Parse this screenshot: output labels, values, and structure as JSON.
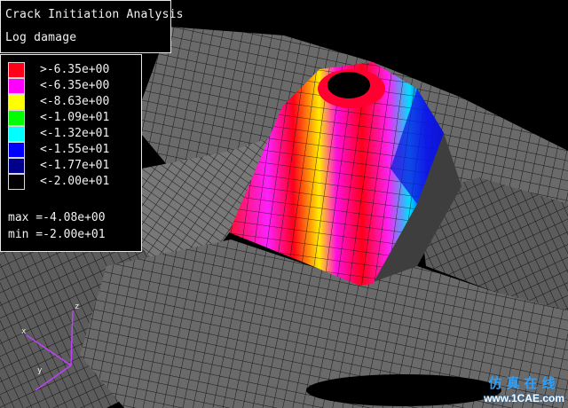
{
  "title_panel": {
    "line1": "Crack Initiation Analysis",
    "line2": "Log damage"
  },
  "legend": {
    "entries": [
      {
        "label": ">-6.35e+00",
        "color": "#ff0018"
      },
      {
        "label": "<-6.35e+00",
        "color": "#ff00ff"
      },
      {
        "label": "<-8.63e+00",
        "color": "#ffff00"
      },
      {
        "label": "<-1.09e+01",
        "color": "#00ff00"
      },
      {
        "label": "<-1.32e+01",
        "color": "#00ffff"
      },
      {
        "label": "<-1.55e+01",
        "color": "#0000ff"
      },
      {
        "label": "<-1.77e+01",
        "color": "#00008a"
      },
      {
        "label": "<-2.00e+01",
        "color": "#000000"
      }
    ],
    "max": "max =-4.08e+00",
    "min": "min =-2.00e+01"
  },
  "triad": {
    "x": "x",
    "y": "y",
    "z": "z"
  },
  "watermark": {
    "cn": "仿真在线",
    "url": "www.1CAE.com"
  },
  "colors": {
    "background": "#000000",
    "mesh_fill": "#6e6e6e",
    "mesh_line": "#1a1a1a",
    "triad": "#c040ff"
  }
}
